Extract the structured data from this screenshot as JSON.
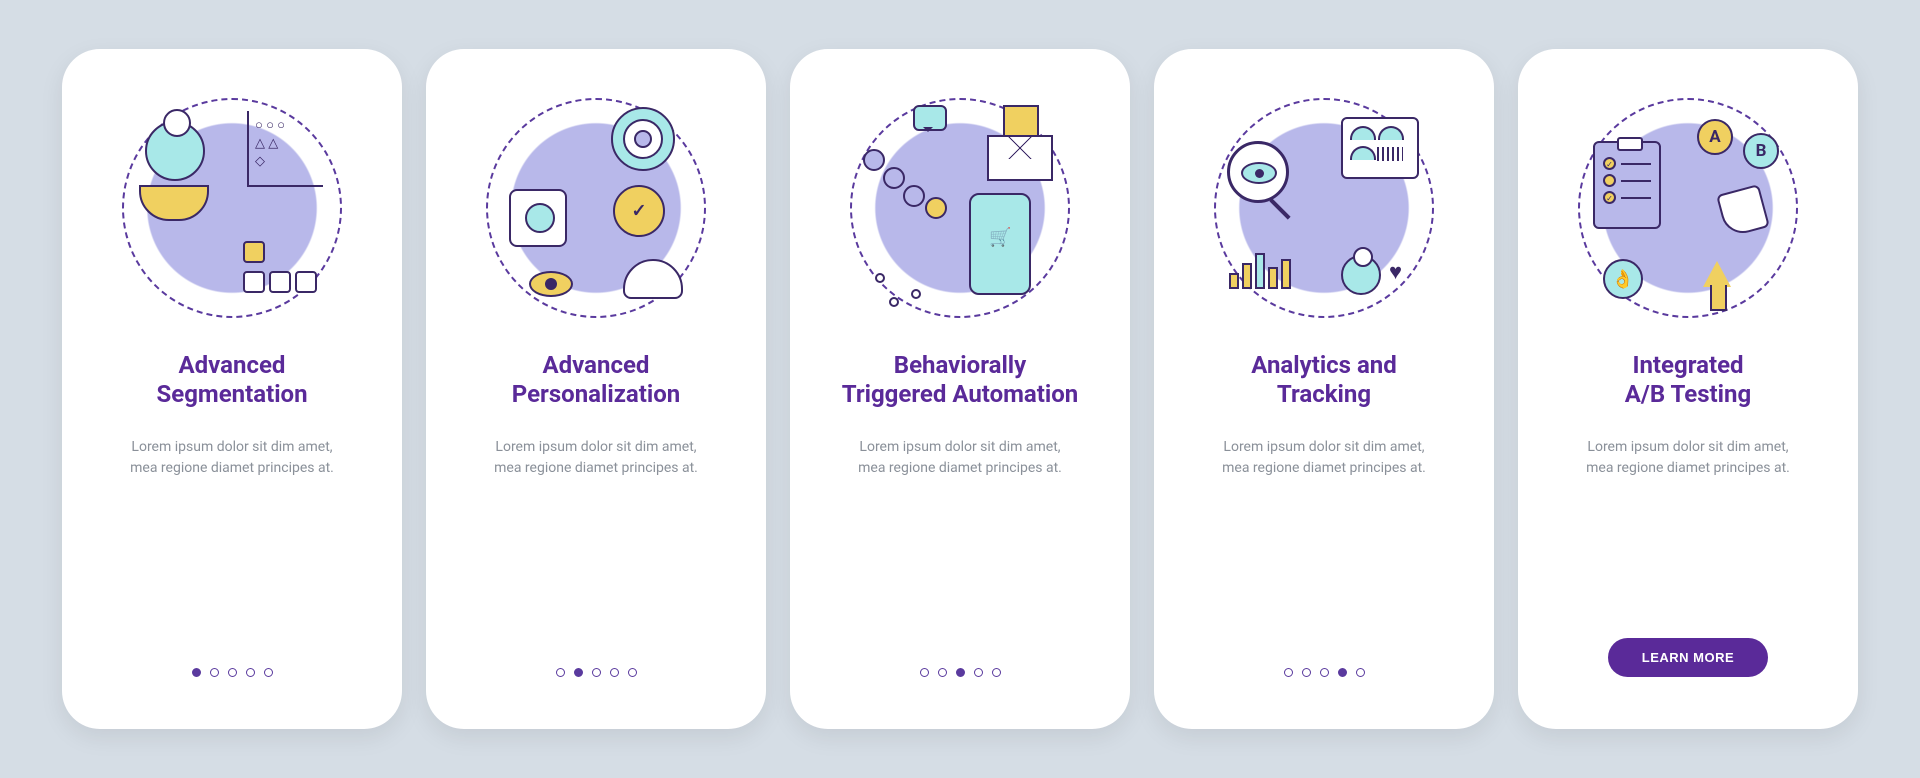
{
  "screens": [
    {
      "title_line1": "Advanced",
      "title_line2": "Segmentation",
      "description": "Lorem ipsum dolor sit dim amet, mea regione diamet principes at.",
      "active_dot": 0
    },
    {
      "title_line1": "Advanced",
      "title_line2": "Personalization",
      "description": "Lorem ipsum dolor sit dim amet, mea regione diamet principes at.",
      "active_dot": 1
    },
    {
      "title_line1": "Behaviorally",
      "title_line2": "Triggered Automation",
      "description": "Lorem ipsum dolor sit dim amet, mea regione diamet principes at.",
      "active_dot": 2
    },
    {
      "title_line1": "Analytics and",
      "title_line2": "Tracking",
      "description": "Lorem ipsum dolor sit dim amet, mea regione diamet principes at.",
      "active_dot": 3
    },
    {
      "title_line1": "Integrated",
      "title_line2": "A/B Testing",
      "description": "Lorem ipsum dolor sit dim amet, mea regione diamet principes at.",
      "active_dot": 4,
      "cta": "LEARN MORE"
    }
  ],
  "ab_labels": {
    "a": "A",
    "b": "B"
  },
  "dot_count": 5
}
